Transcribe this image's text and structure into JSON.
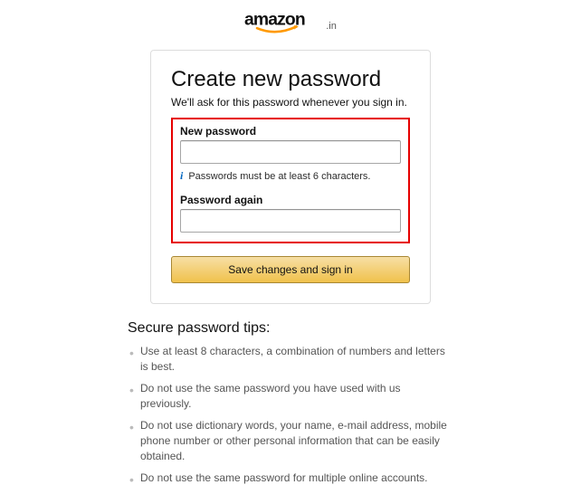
{
  "logo": {
    "alt": "amazon",
    "suffix": ".in"
  },
  "card": {
    "title": "Create new password",
    "subtitle": "We'll ask for this password whenever you sign in.",
    "new_password_label": "New password",
    "hint": "Passwords must be at least 6 characters.",
    "password_again_label": "Password again",
    "button_label": "Save changes and sign in"
  },
  "tips": {
    "heading": "Secure password tips:",
    "items": [
      "Use at least 8 characters, a combination of numbers and letters is best.",
      "Do not use the same password you have used with us previously.",
      "Do not use dictionary words, your name, e-mail address, mobile phone number or other personal information that can be easily obtained.",
      "Do not use the same password for multiple online accounts."
    ]
  }
}
